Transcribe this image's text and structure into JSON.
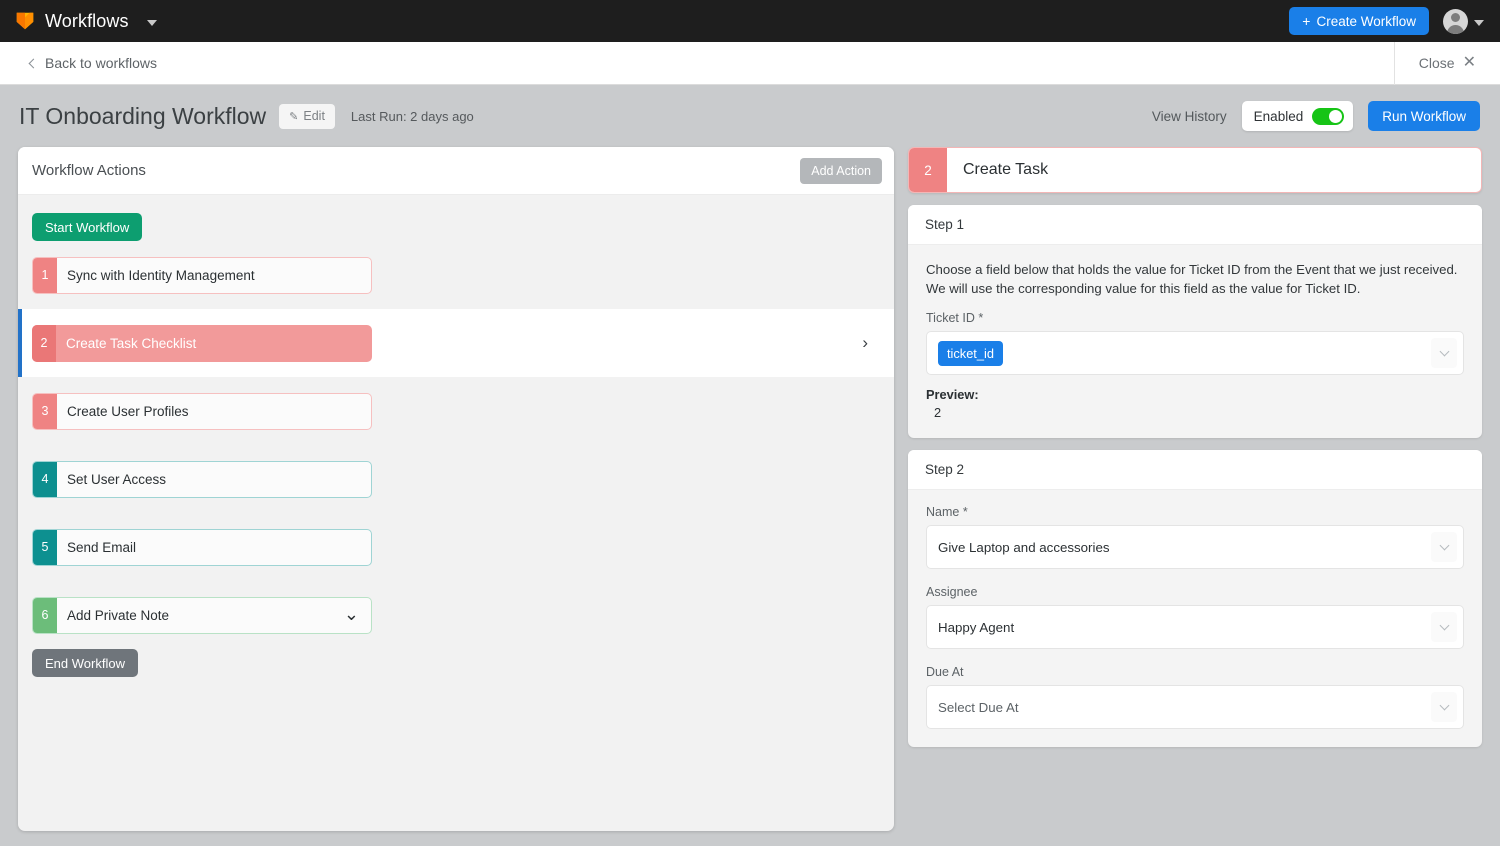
{
  "topbar": {
    "logo_icon": "freshworks-logo-icon",
    "product_title": "Workflows",
    "caret_icon": "chevron-down-icon",
    "create_button": "Create Workflow",
    "create_plus": "+",
    "avatar_icon": "user-avatar-icon",
    "avatar_caret_icon": "chevron-down-icon",
    "accent_blue": "#1a7fe8",
    "background": "#1e1e1e"
  },
  "subbar": {
    "back_label": "Back to workflows",
    "back_icon": "chevron-left-icon",
    "close_label": "Close",
    "close_icon": "close-x-icon"
  },
  "page_header": {
    "title": "IT Onboarding Workflow",
    "edit_label": "Edit",
    "edit_icon": "pencil-icon",
    "last_run": "Last Run: 2 days ago",
    "view_history": "View History",
    "toggle_label": "Enabled",
    "toggle_state": "on",
    "toggle_color": "#16c416",
    "run_label": "Run Workflow"
  },
  "left_panel": {
    "title": "Workflow Actions",
    "add_action_label": "Add Action",
    "start_label": "Start Workflow",
    "end_label": "End Workflow",
    "selected_index": 2,
    "chevron_right_icon": "chevron-right-icon",
    "actions": [
      {
        "num": "1",
        "label": "Sync with Identity Management",
        "style": "outline-red",
        "badge_color": "#ef8383"
      },
      {
        "num": "2",
        "label": "Create Task Checklist",
        "style": "filled-red",
        "badge_color": "#ea7777"
      },
      {
        "num": "3",
        "label": "Create User Profiles",
        "style": "outline-red",
        "badge_color": "#ef8383"
      },
      {
        "num": "4",
        "label": "Set User Access",
        "style": "outline-teal",
        "badge_color": "#0d8f8f"
      },
      {
        "num": "5",
        "label": "Send Email",
        "style": "outline-teal",
        "badge_color": "#0d9090"
      },
      {
        "num": "6",
        "label": "Add Private Note",
        "style": "outline-green",
        "badge_color": "#6cbd7a"
      }
    ]
  },
  "right_panel": {
    "header": {
      "num": "2",
      "label": "Create Task",
      "badge_color": "#ef8383"
    },
    "step1": {
      "title": "Step 1",
      "description": "Choose a field below that holds the value for Ticket ID from the Event that we just received. We will use the corresponding value for this field as the value for Ticket ID.",
      "field_label": "Ticket ID *",
      "token_value": "ticket_id",
      "caret_icon": "chevron-down-icon",
      "preview_label": "Preview:",
      "preview_value": "2"
    },
    "step2": {
      "title": "Step 2",
      "fields": [
        {
          "label": "Name *",
          "value": "Give Laptop and accessories",
          "placeholder": false,
          "caret_icon": "chevron-down-icon"
        },
        {
          "label": "Assignee",
          "value": "Happy Agent",
          "placeholder": false,
          "caret_icon": "chevron-down-icon"
        },
        {
          "label": "Due At",
          "value": "Select Due At",
          "placeholder": true,
          "caret_icon": "chevron-down-icon"
        }
      ]
    }
  }
}
